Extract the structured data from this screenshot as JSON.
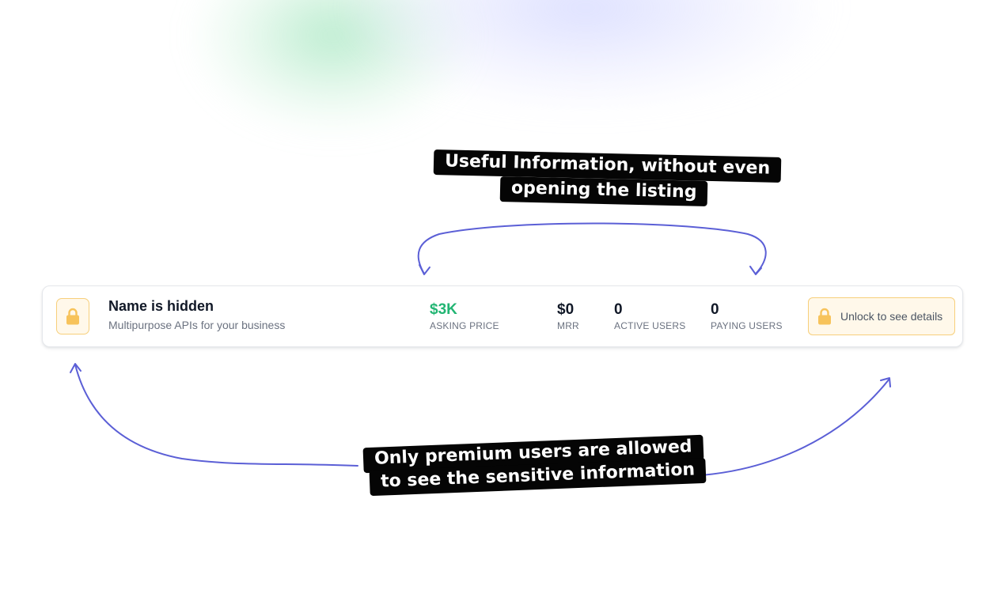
{
  "callouts": {
    "top_line1": "Useful Information, without even",
    "top_line2": "opening the listing",
    "bottom_line1": "Only premium users are allowed",
    "bottom_line2": "to see the sensitive information"
  },
  "listing": {
    "title": "Name is hidden",
    "subtitle": "Multipurpose APIs for your business",
    "metrics": [
      {
        "value": "$3K",
        "label": "ASKING PRICE"
      },
      {
        "value": "$0",
        "label": "MRR"
      },
      {
        "value": "0",
        "label": "ACTIVE USERS"
      },
      {
        "value": "0",
        "label": "PAYING USERS"
      }
    ],
    "unlock_label": "Unlock to see details"
  },
  "icons": {
    "lock": "lock-icon"
  },
  "colors": {
    "asking_price": "#22b573",
    "lock_accent": "#f7c35b",
    "arrow": "#5b5fd6",
    "callout_bg": "#050505"
  }
}
